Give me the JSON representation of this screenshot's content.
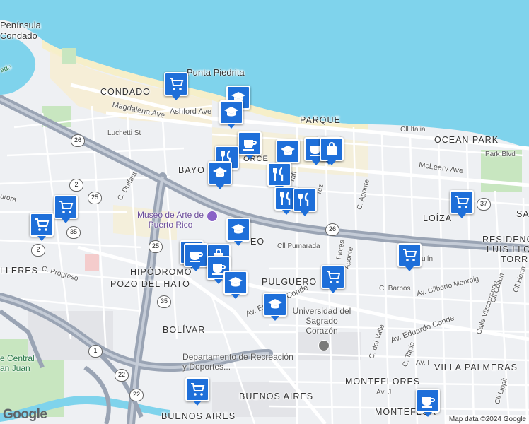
{
  "map": {
    "neighborhoods": [
      "Península",
      "Condado",
      "CONDADO",
      "Punta Piedrita",
      "PARQUE",
      "OCEAN PARK",
      "BAYO",
      "LOÍZA",
      "RESIDENC",
      "LUIS LLOR",
      "TORRE",
      "HIPÓDROMO",
      "POZO DEL HATO",
      "PULGUERO",
      "BOLÍVAR",
      "MONTEFLORES",
      "VILLA PALMERAS",
      "BUENOS AIRES",
      "MONTEFLOR",
      "LLERES",
      "SA",
      "EO",
      "ORCE"
    ],
    "streets": [
      "Ashford Ave",
      "Magdalena Ave",
      "Luchetti St",
      "Cll Italia",
      "Park Blvd",
      "McLeary Ave",
      "C. Duffaut",
      "urora",
      "C. Progreso",
      "Cll Pumarada",
      "Av. Eduardo Conde",
      "Av. Eduardo Conde",
      "Av. Gilberto Monroig",
      "C. Barbos",
      "Calle Vizcarrondo",
      "Cll Colton",
      "Cll Henn",
      "C. del Valle",
      "C. Tapia",
      "Av. I",
      "Av. J",
      "Cll Lippit",
      "C. Aponte",
      "Flores",
      "Aponte",
      "rez",
      "raft",
      "ulín",
      "ado"
    ],
    "pois": [
      "Museo de Arte de Puerto Rico",
      "Universidad del Sagrado Corazón",
      "Departamento de Recreación y Deportes...",
      "e Central an Juan"
    ],
    "shields": [
      "26",
      "26",
      "2",
      "2",
      "25",
      "25",
      "35",
      "35",
      "37",
      "1",
      "22",
      "22"
    ]
  },
  "markers": [
    {
      "icon": "cart",
      "kind": "shopping"
    },
    {
      "icon": "school",
      "kind": "school"
    },
    {
      "icon": "school",
      "kind": "school"
    },
    {
      "icon": "coffee",
      "kind": "cafe"
    },
    {
      "icon": "bag",
      "kind": "store"
    },
    {
      "icon": "school",
      "kind": "school"
    },
    {
      "icon": "restaurant",
      "kind": "restaurant"
    },
    {
      "icon": "school",
      "kind": "school"
    },
    {
      "icon": "restaurant",
      "kind": "restaurant"
    },
    {
      "icon": "restaurant",
      "kind": "restaurant"
    },
    {
      "icon": "restaurant",
      "kind": "restaurant"
    },
    {
      "icon": "coffee",
      "kind": "cafe"
    },
    {
      "icon": "bag",
      "kind": "store"
    },
    {
      "icon": "school",
      "kind": "school"
    },
    {
      "icon": "coffee",
      "kind": "cafe"
    },
    {
      "icon": "bag",
      "kind": "store"
    },
    {
      "icon": "coffee",
      "kind": "cafe"
    },
    {
      "icon": "coffee",
      "kind": "cafe"
    },
    {
      "icon": "school",
      "kind": "school"
    },
    {
      "icon": "cart",
      "kind": "shopping"
    },
    {
      "icon": "cart",
      "kind": "shopping"
    },
    {
      "icon": "cart",
      "kind": "shopping"
    },
    {
      "icon": "school",
      "kind": "school"
    },
    {
      "icon": "cart",
      "kind": "shopping"
    },
    {
      "icon": "cart",
      "kind": "shopping"
    },
    {
      "icon": "cart",
      "kind": "shopping"
    },
    {
      "icon": "coffee",
      "kind": "cafe"
    }
  ],
  "colors": {
    "water": "#7fd3ec",
    "marker": "#1e6fd9",
    "land": "#eef0f3",
    "park": "#c8e6c0",
    "highway": "#9aa4b4"
  },
  "attribution": "Map data ©2024 Google",
  "logo": "Google"
}
